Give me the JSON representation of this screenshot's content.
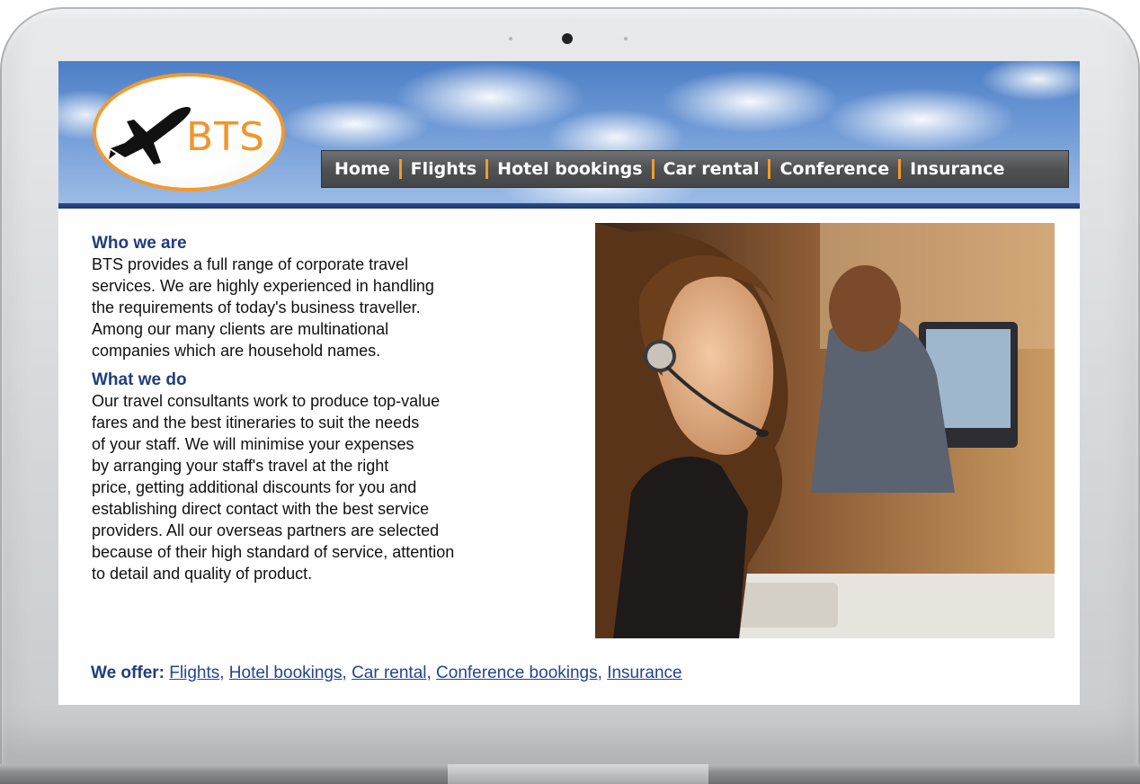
{
  "site": {
    "logo_text": "BTS",
    "accent_color": "#f29a2e",
    "brand_blue": "#203d7c"
  },
  "nav": {
    "items": [
      {
        "label": "Home"
      },
      {
        "label": "Flights"
      },
      {
        "label": "Hotel bookings"
      },
      {
        "label": "Car rental"
      },
      {
        "label": "Conference"
      },
      {
        "label": "Insurance"
      }
    ]
  },
  "main": {
    "who_heading": "Who we are",
    "who_lines": [
      "BTS provides a full range of corporate travel",
      "services. We are highly experienced in handling",
      "the requirements of today's business traveller.",
      "Among our many clients are multinational",
      "companies which are household names."
    ],
    "what_heading": "What we do",
    "what_lines": [
      "Our travel consultants work to produce top-value",
      "fares and the best itineraries to suit the needs",
      "of your staff. We will minimise your expenses",
      "by arranging your staff's travel at the right",
      "price, getting additional discounts for you and",
      "establishing direct contact with the best service",
      "providers. All our overseas partners are selected",
      "because of their high standard of service, attention",
      "to detail and quality of product."
    ],
    "photo_icon": "call-center-agent-photo"
  },
  "offer": {
    "label": "We offer:",
    "links": [
      "Flights",
      "Hotel bookings",
      "Car rental",
      "Conference bookings",
      "Insurance"
    ]
  }
}
